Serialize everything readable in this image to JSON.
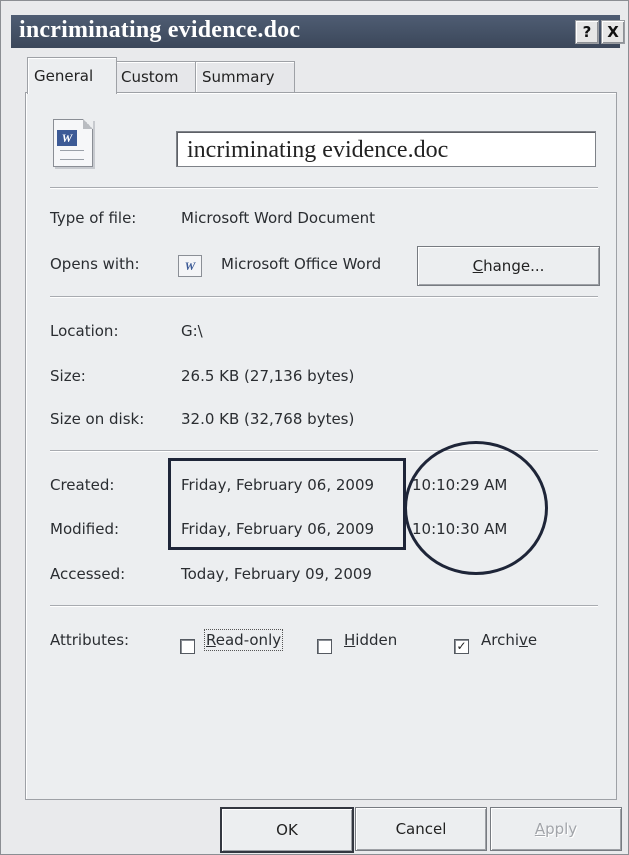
{
  "window": {
    "title": "incriminating evidence.doc",
    "help_label": "?",
    "close_label": "X"
  },
  "tabs": [
    {
      "label": "General"
    },
    {
      "label": "Custom"
    },
    {
      "label": "Summary"
    }
  ],
  "file": {
    "name": "incriminating evidence.doc",
    "icon": "word-document-icon"
  },
  "fields": {
    "type_label": "Type of file:",
    "type_value": "Microsoft Word Document",
    "opens_label": "Opens with:",
    "opens_value": "Microsoft Office Word",
    "opens_icon": "word-app-icon",
    "change_label": "Change...",
    "location_label": "Location:",
    "location_value": "G:\\",
    "size_label": "Size:",
    "size_value": "26.5 KB (27,136 bytes)",
    "size_disk_label": "Size on disk:",
    "size_disk_value": "32.0 KB (32,768 bytes)",
    "created_label": "Created:",
    "created_date": "Friday, February 06, 2009",
    "created_time": "10:10:29 AM",
    "modified_label": "Modified:",
    "modified_date": "Friday, February 06, 2009",
    "modified_time": "10:10:30 AM",
    "accessed_label": "Accessed:",
    "accessed_value": "Today, February 09, 2009"
  },
  "attributes": {
    "label": "Attributes:",
    "readonly": {
      "label": "Read-only",
      "checked": false
    },
    "hidden": {
      "label": "Hidden",
      "checked": false
    },
    "archive": {
      "label": "Archive",
      "checked": true
    }
  },
  "buttons": {
    "ok": "OK",
    "cancel": "Cancel",
    "apply": "Apply"
  }
}
